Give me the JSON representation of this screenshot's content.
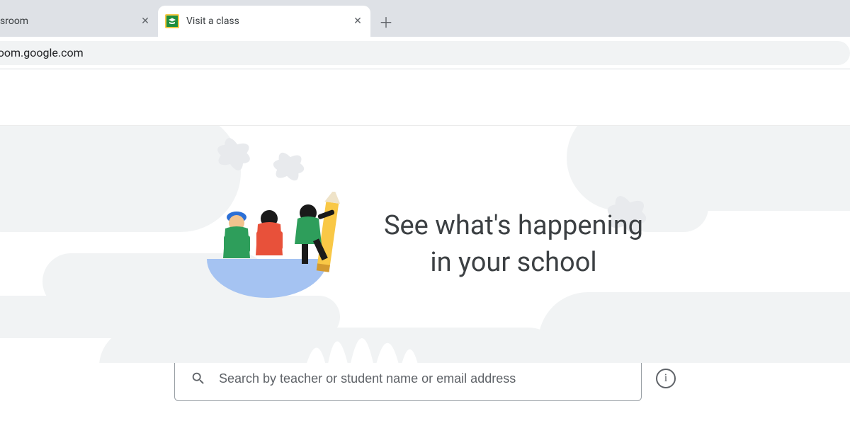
{
  "browser": {
    "tabs": [
      {
        "title": "sroom",
        "active": false
      },
      {
        "title": "Visit a class",
        "active": true
      }
    ],
    "address": "classroom.google.com"
  },
  "hero": {
    "line1": "See what's happening",
    "line2": "in your school"
  },
  "search": {
    "placeholder": "Search by teacher or student name or email address",
    "value": ""
  },
  "icons": {
    "close_glyph": "✕",
    "plus_glyph": "＋",
    "info_glyph": "i"
  }
}
